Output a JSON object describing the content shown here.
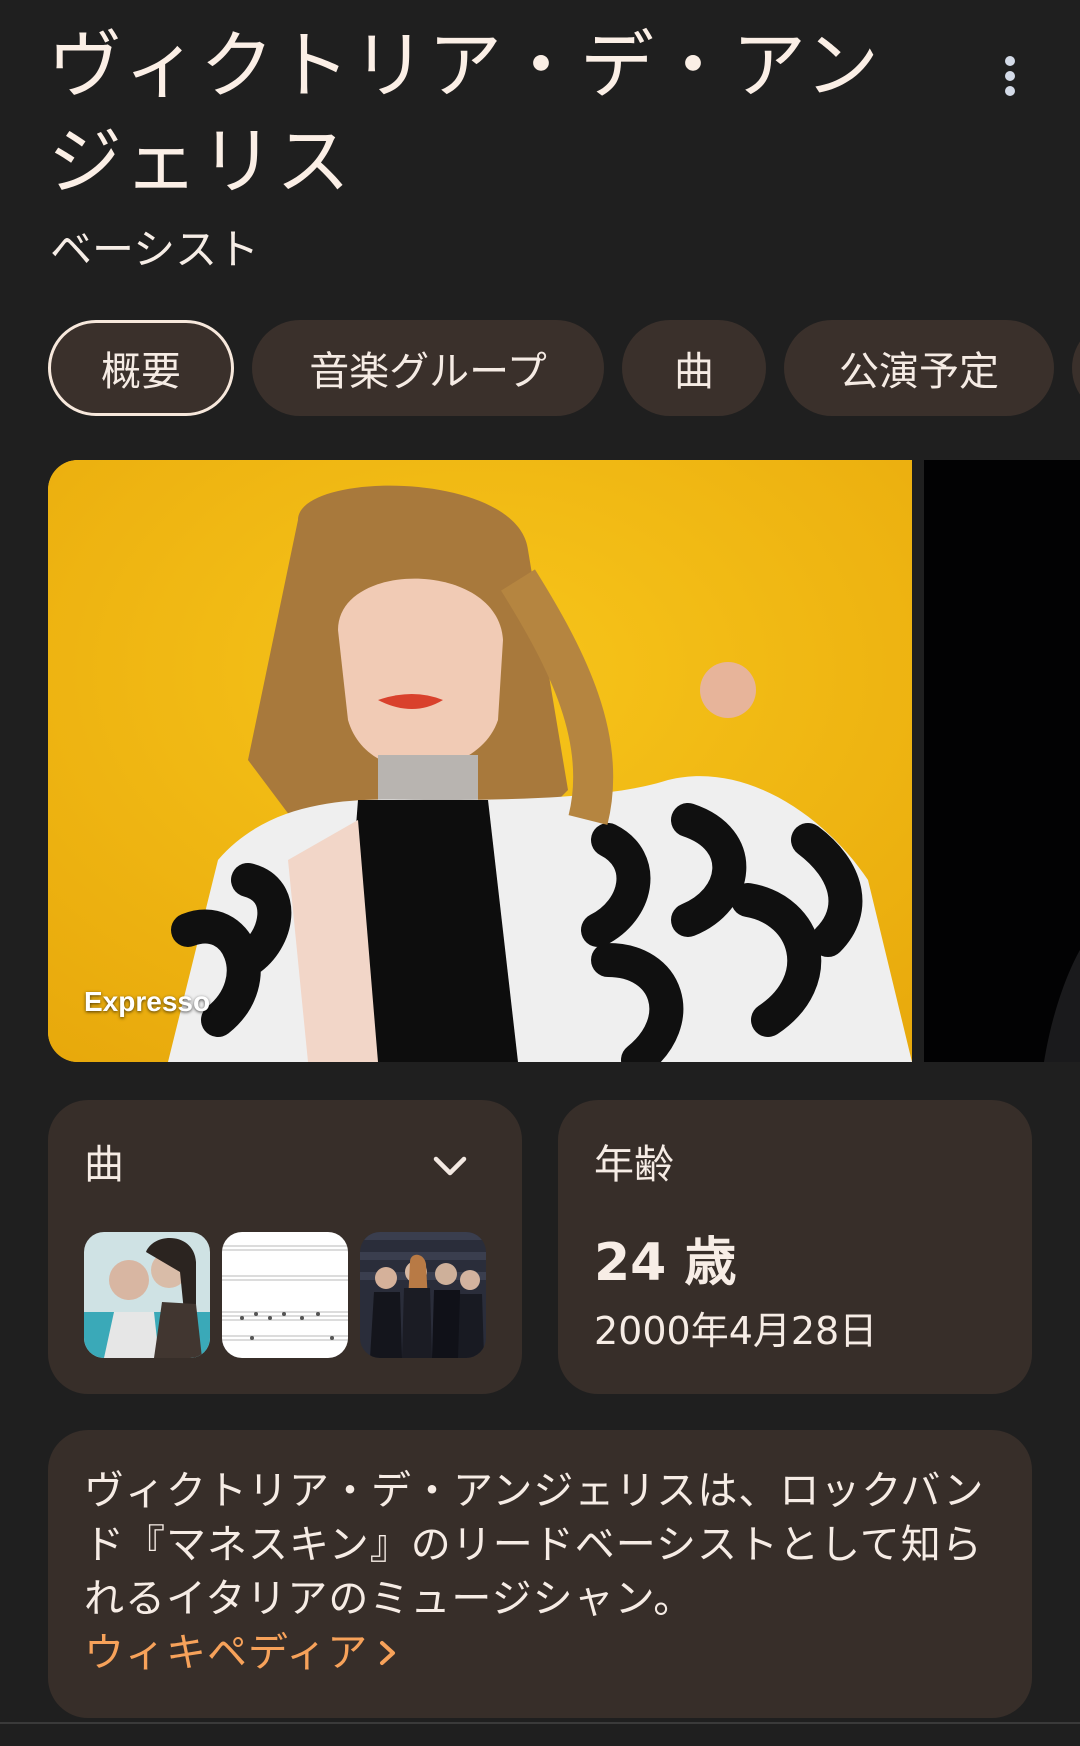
{
  "header": {
    "title": "ヴィクトリア・デ・アンジェリス",
    "subtitle": "ベーシスト",
    "more_icon": "more-vert-icon"
  },
  "tabs": [
    {
      "label": "概要",
      "active": true
    },
    {
      "label": "音楽グループ",
      "active": false
    },
    {
      "label": "曲",
      "active": false
    },
    {
      "label": "公演予定",
      "active": false
    }
  ],
  "hero": {
    "caption": "Expresso"
  },
  "songs_card": {
    "heading": "曲",
    "expand_icon": "chevron-down-icon"
  },
  "age_card": {
    "heading": "年齢",
    "value": "24 歳",
    "birthdate": "2000年4月28日"
  },
  "description": {
    "text": "ヴィクトリア・デ・アンジェリスは、ロックバンド『マネスキン』のリードベーシストとして知られるイタリアのミュージシャン。",
    "link_label": "ウィキペディア"
  },
  "colors": {
    "background": "#1f1f1f",
    "card": "#372e29",
    "chip": "#3a302b",
    "link": "#f7a25a",
    "hero_bg": "#f2b80f"
  }
}
